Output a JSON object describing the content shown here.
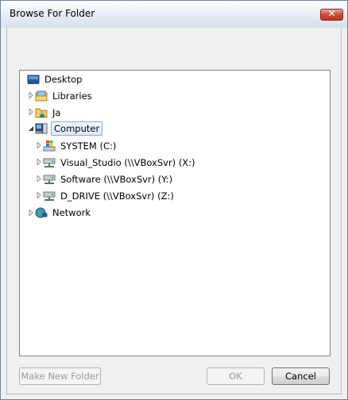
{
  "window": {
    "title": "Browse For Folder"
  },
  "tree": {
    "items": [
      {
        "label": "Desktop",
        "icon": "desktop-icon"
      },
      {
        "label": "Libraries",
        "icon": "libraries-icon"
      },
      {
        "label": "Ja",
        "icon": "user-folder-icon"
      },
      {
        "label": "Computer",
        "icon": "computer-icon",
        "selected": true
      },
      {
        "label": "SYSTEM (C:)",
        "icon": "windows-drive-icon"
      },
      {
        "label": "Visual_Studio (\\\\VBoxSvr) (X:)",
        "icon": "network-drive-icon"
      },
      {
        "label": "Software (\\\\VBoxSvr) (Y:)",
        "icon": "network-drive-icon"
      },
      {
        "label": "D_DRIVE (\\\\VBoxSvr) (Z:)",
        "icon": "network-drive-icon"
      },
      {
        "label": "Network",
        "icon": "network-icon"
      }
    ]
  },
  "buttons": {
    "make_new_folder": "Make New Folder",
    "ok": "OK",
    "cancel": "Cancel"
  }
}
